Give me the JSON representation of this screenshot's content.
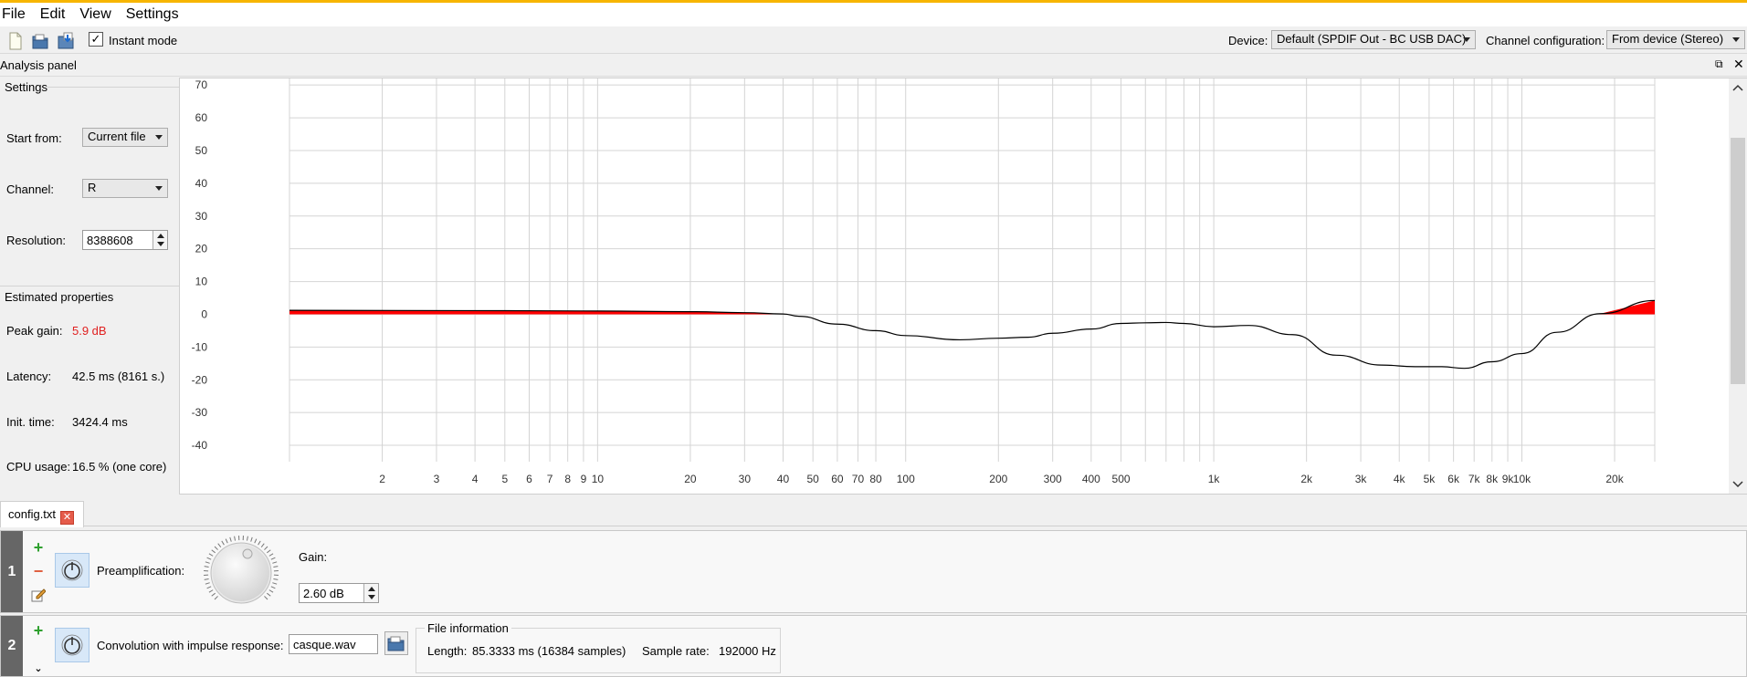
{
  "menu": [
    "File",
    "Edit",
    "View",
    "Settings"
  ],
  "toolbar": {
    "instant_mode_label": "Instant mode",
    "instant_mode_checked": true,
    "device_label": "Device:",
    "device_value": "Default (SPDIF Out - BC USB DAC)",
    "channel_config_label": "Channel configuration:",
    "channel_config_value": "From device (Stereo)"
  },
  "analysis_panel": {
    "title": "Analysis panel",
    "settings_title": "Settings",
    "start_from_label": "Start from:",
    "start_from_value": "Current file",
    "channel_label": "Channel:",
    "channel_value": "R",
    "resolution_label": "Resolution:",
    "resolution_value": "8388608",
    "estimated_title": "Estimated properties",
    "peak_gain_label": "Peak gain:",
    "peak_gain_value": "5.9 dB",
    "latency_label": "Latency:",
    "latency_value": "42.5 ms (8161 s.)",
    "init_time_label": "Init. time:",
    "init_time_value": "3424.4 ms",
    "cpu_usage_label": "CPU usage:",
    "cpu_usage_value": "16.5 % (one core)"
  },
  "chart_data": {
    "type": "line",
    "x_scale": "log",
    "xlim": [
      1,
      27000
    ],
    "ylim": [
      -45,
      72
    ],
    "y_ticks": [
      70,
      60,
      50,
      40,
      30,
      20,
      10,
      0,
      -10,
      -20,
      -30,
      -40
    ],
    "x_ticks": [
      {
        "v": 2,
        "label": "2"
      },
      {
        "v": 3,
        "label": "3"
      },
      {
        "v": 4,
        "label": "4"
      },
      {
        "v": 5,
        "label": "5"
      },
      {
        "v": 6,
        "label": "6"
      },
      {
        "v": 7,
        "label": "7"
      },
      {
        "v": 8,
        "label": "8"
      },
      {
        "v": 9,
        "label": "9"
      },
      {
        "v": 10,
        "label": "10"
      },
      {
        "v": 20,
        "label": "20"
      },
      {
        "v": 30,
        "label": "30"
      },
      {
        "v": 40,
        "label": "40"
      },
      {
        "v": 50,
        "label": "50"
      },
      {
        "v": 60,
        "label": "60"
      },
      {
        "v": 70,
        "label": "70"
      },
      {
        "v": 80,
        "label": "80"
      },
      {
        "v": 100,
        "label": "100"
      },
      {
        "v": 200,
        "label": "200"
      },
      {
        "v": 300,
        "label": "300"
      },
      {
        "v": 400,
        "label": "400"
      },
      {
        "v": 500,
        "label": "500"
      },
      {
        "v": 1000,
        "label": "1k"
      },
      {
        "v": 2000,
        "label": "2k"
      },
      {
        "v": 3000,
        "label": "3k"
      },
      {
        "v": 4000,
        "label": "4k"
      },
      {
        "v": 5000,
        "label": "5k"
      },
      {
        "v": 6000,
        "label": "6k"
      },
      {
        "v": 7000,
        "label": "7k"
      },
      {
        "v": 8000,
        "label": "8k"
      },
      {
        "v": 9000,
        "label": "9k"
      },
      {
        "v": 10000,
        "label": "10k"
      },
      {
        "v": 20000,
        "label": "20k"
      }
    ],
    "extra_gridlines": [
      600,
      700,
      800,
      900
    ],
    "grid": true,
    "series": [
      {
        "color": "#000000",
        "positive_fill": "#ff0000",
        "x": [
          1,
          5,
          10,
          20,
          30,
          40,
          45,
          60,
          80,
          100,
          150,
          200,
          250,
          300,
          400,
          500,
          600,
          700,
          800,
          1000,
          1300,
          1800,
          2500,
          3500,
          4500,
          5500,
          6500,
          8000,
          10000,
          13000,
          18000,
          27000
        ],
        "y": [
          1.2,
          1.1,
          1.0,
          0.8,
          0.5,
          0.1,
          -0.6,
          -3,
          -5,
          -6.5,
          -7.8,
          -7.3,
          -7.0,
          -5.8,
          -4.5,
          -2.8,
          -2.6,
          -2.5,
          -2.8,
          -3.8,
          -3.4,
          -6.2,
          -12.5,
          -15.5,
          -16.0,
          -16.0,
          -16.5,
          -14.5,
          -12.0,
          -5.5,
          0.2,
          4.2
        ]
      }
    ]
  },
  "tab": {
    "label": "config.txt"
  },
  "filters": [
    {
      "number": "1",
      "title": "Preamplification:",
      "gain_label": "Gain:",
      "gain_value": "2.60 dB"
    },
    {
      "number": "2",
      "title": "Convolution with impulse response:",
      "file_value": "casque.wav",
      "info_title": "File information",
      "length_label": "Length:",
      "length_value": "85.3333 ms (16384 samples)",
      "sample_rate_label": "Sample rate:",
      "sample_rate_value": "192000 Hz"
    }
  ]
}
